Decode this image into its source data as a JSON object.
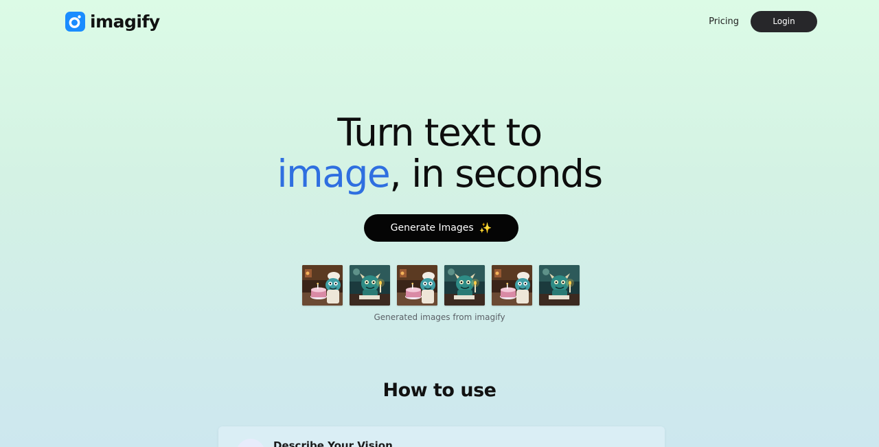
{
  "brand": {
    "name": "imagify",
    "color": "#1a8cff"
  },
  "nav": {
    "pricing_label": "Pricing",
    "login_label": "Login"
  },
  "hero": {
    "title_line1": "Turn text to",
    "title_accent": "image",
    "title_rest": ", in seconds",
    "accent_color": "#2f6fe0",
    "cta_label": "Generate Images",
    "cta_icon": "sparkle-icon"
  },
  "gallery": {
    "caption": "Generated images from imagify",
    "images": [
      {
        "subject": "monster-chef-with-cake"
      },
      {
        "subject": "monster-with-candle"
      },
      {
        "subject": "monster-chef-with-cake"
      },
      {
        "subject": "monster-with-candle"
      },
      {
        "subject": "monster-chef-with-cake"
      },
      {
        "subject": "monster-with-candle"
      }
    ]
  },
  "how_to_use": {
    "title": "How to use",
    "steps": [
      {
        "title": "Describe Your Vision"
      }
    ]
  }
}
